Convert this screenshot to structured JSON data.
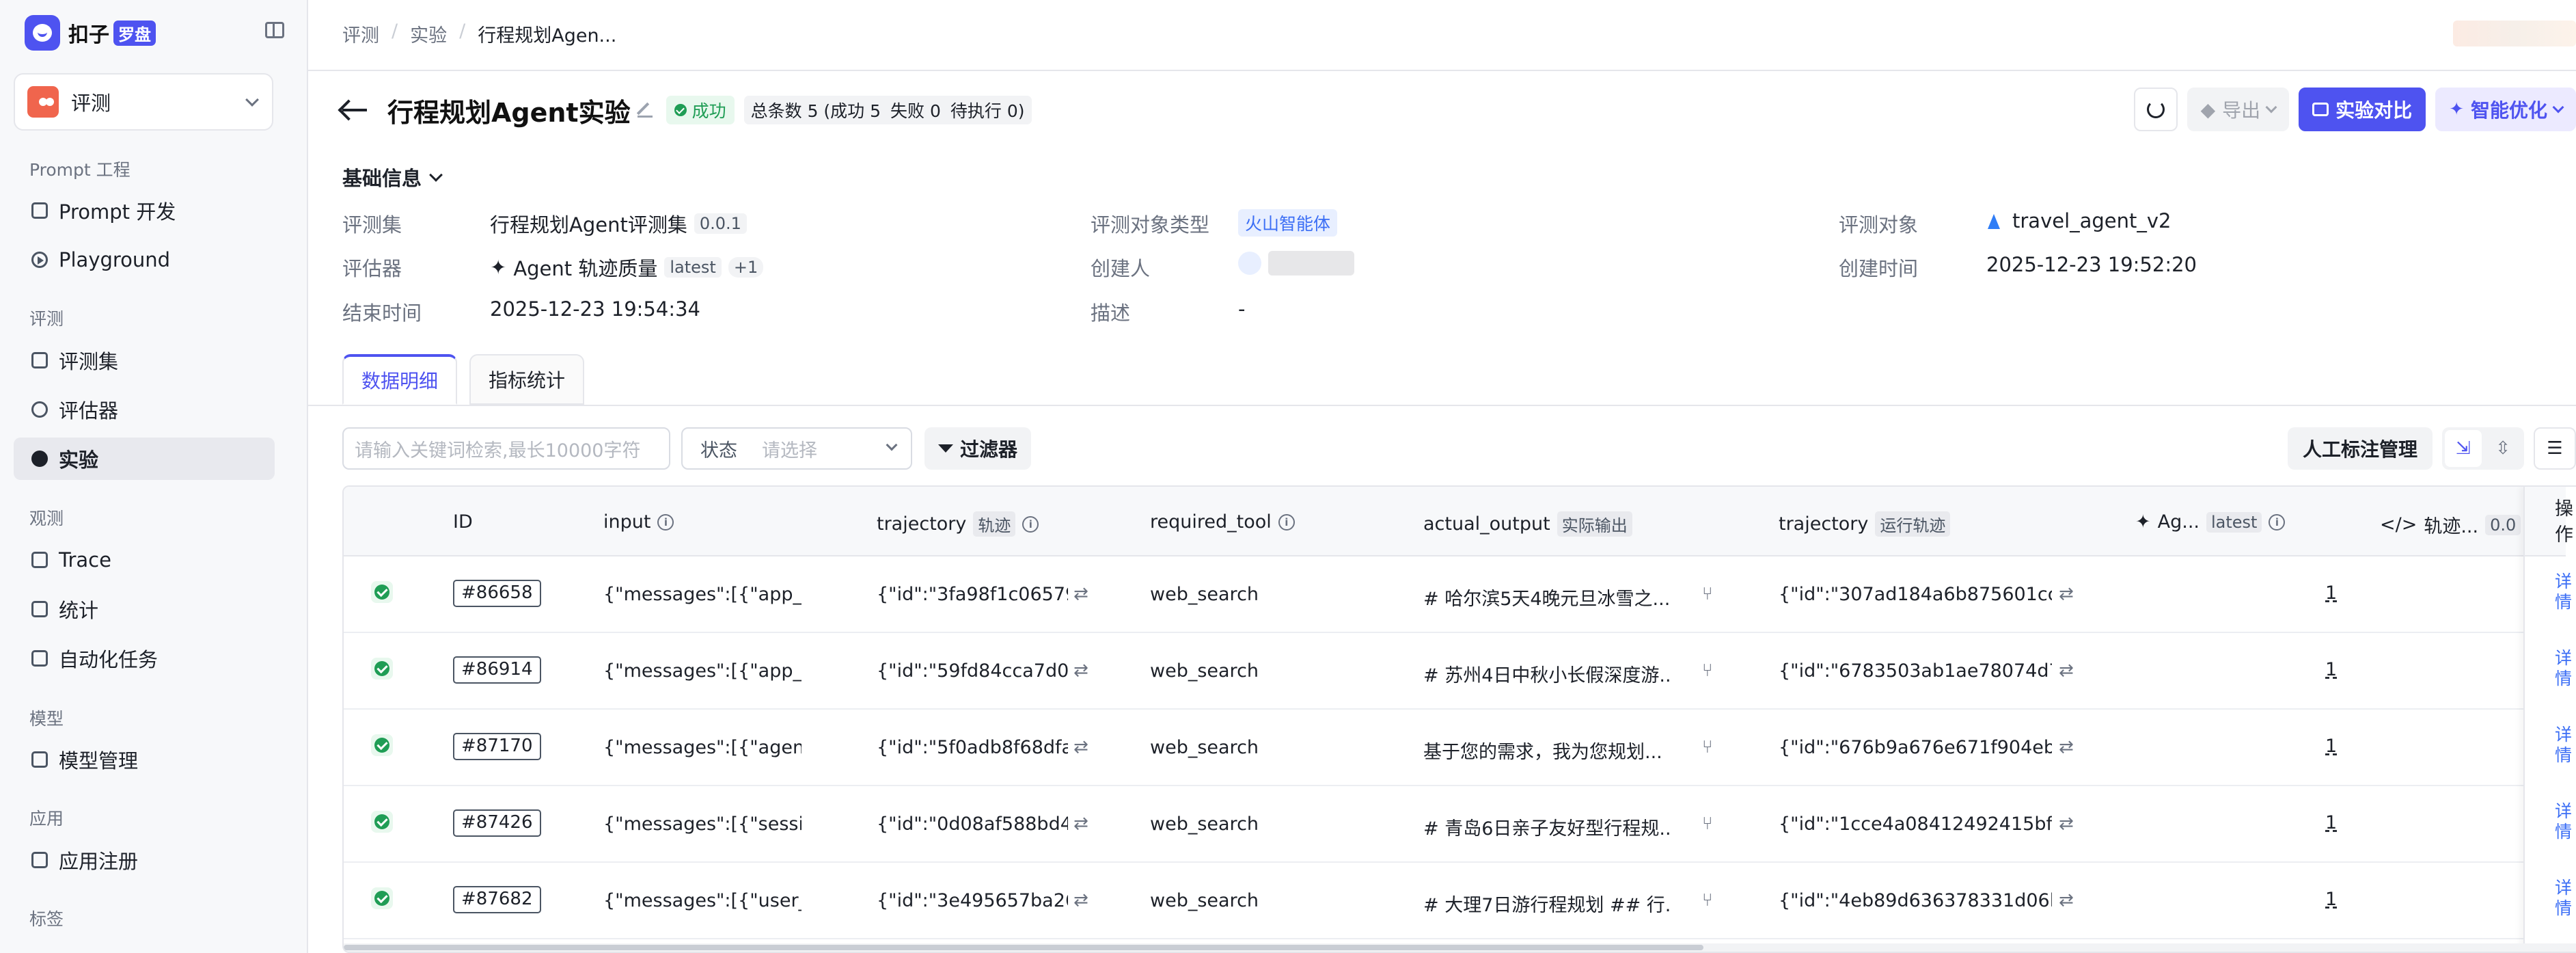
{
  "sidebar": {
    "logo_text": "扣子",
    "logo_badge": "罗盘",
    "workspace": "评测",
    "sections": [
      {
        "title": "Prompt 工程",
        "items": [
          "Prompt 开发",
          "Playground"
        ]
      },
      {
        "title": "评测",
        "items": [
          "评测集",
          "评估器",
          "实验"
        ]
      },
      {
        "title": "观测",
        "items": [
          "Trace",
          "统计",
          "自动化任务"
        ]
      },
      {
        "title": "模型",
        "items": [
          "模型管理"
        ]
      },
      {
        "title": "应用",
        "items": [
          "应用注册"
        ]
      },
      {
        "title": "标签",
        "items": []
      }
    ],
    "active_item": "实验"
  },
  "breadcrumb": [
    "评测",
    "实验",
    "行程规划Agen..."
  ],
  "header": {
    "title": "行程规划Agent实验",
    "status": "成功",
    "counts": [
      "总条数 5 (成功 5",
      "失败 0",
      "待执行 0)"
    ],
    "export_label": "导出",
    "compare_label": "实验对比",
    "optimize_label": "智能优化"
  },
  "basic_info": {
    "section_title": "基础信息",
    "fields": [
      {
        "label": "评测集",
        "value": "行程规划Agent评测集",
        "tag": "0.0.1"
      },
      {
        "label": "评测对象类型",
        "value": "火山智能体"
      },
      {
        "label": "评测对象",
        "value": "travel_agent_v2"
      },
      {
        "label": "评估器",
        "value": "Agent 轨迹质量",
        "tag": "latest",
        "extra": "+1"
      },
      {
        "label": "创建人",
        "value": ""
      },
      {
        "label": "创建时间",
        "value": "2025-12-23 19:52:20"
      },
      {
        "label": "结束时间",
        "value": "2025-12-23 19:54:34"
      },
      {
        "label": "描述",
        "value": "-"
      }
    ]
  },
  "tabs": [
    "数据明细",
    "指标统计"
  ],
  "toolbar": {
    "search_placeholder": "请输入关键词检索,最长10000字符",
    "status_label": "状态",
    "status_placeholder": "请选择",
    "filter_label": "过滤器",
    "annotation_label": "人工标注管理"
  },
  "table": {
    "columns": {
      "id": "ID",
      "input": "input",
      "trajectory": "trajectory",
      "trajectory_sub": "轨迹",
      "required_tool": "required_tool",
      "actual_output": "actual_output",
      "actual_output_sub": "实际输出",
      "trajectory2": "trajectory",
      "trajectory2_sub": "运行轨迹",
      "evaluator": "Ag...",
      "evaluator_sub": "latest",
      "evaluator2": "轨迹...",
      "evaluator2_sub": "0.0",
      "op": "操作"
    },
    "rows": [
      {
        "id": "#86658",
        "input": "{\"messages\":[{\"app_...",
        "trajectory": "{\"id\":\"3fa98f1c06579...",
        "tool": "web_search",
        "output": "# 哈尔滨5天4晚元旦冰雪之...",
        "run_trajectory": "{\"id\":\"307ad184a6b875601cce...",
        "score": "1",
        "op": "详情"
      },
      {
        "id": "#86914",
        "input": "{\"messages\":[{\"app_...",
        "trajectory": "{\"id\":\"59fd84cca7d0...",
        "tool": "web_search",
        "output": "# 苏州4日中秋小长假深度游...",
        "run_trajectory": "{\"id\":\"6783503ab1ae78074d7c...",
        "score": "1",
        "op": "详情"
      },
      {
        "id": "#87170",
        "input": "{\"messages\":[{\"agen...",
        "trajectory": "{\"id\":\"5f0adb8f68dfa...",
        "tool": "web_search",
        "output": "基于您的需求，我为您规划...",
        "run_trajectory": "{\"id\":\"676b9a676e671f904eb8...",
        "score": "1",
        "op": "详情"
      },
      {
        "id": "#87426",
        "input": "{\"messages\":[{\"sessi...",
        "trajectory": "{\"id\":\"0d08af588bd4...",
        "tool": "web_search",
        "output": "# 青岛6日亲子友好型行程规...",
        "run_trajectory": "{\"id\":\"1cce4a08412492415bf08...",
        "score": "1",
        "op": "详情"
      },
      {
        "id": "#87682",
        "input": "{\"messages\":[{\"user_...",
        "trajectory": "{\"id\":\"3e495657ba26...",
        "tool": "web_search",
        "output": "# 大理7日游行程规划 ## 行...",
        "run_trajectory": "{\"id\":\"4eb89d636378331d06bc...",
        "score": "1",
        "op": "详情"
      }
    ]
  },
  "colors": {
    "brand": "#4e53f0",
    "success": "#1f9d55",
    "link": "#3b6ef5"
  },
  "icons": [
    "back-arrow-icon",
    "edit-icon",
    "refresh-icon",
    "export-icon",
    "compare-icon",
    "sparkle-icon",
    "filter-icon",
    "info-icon",
    "trace-icon"
  ]
}
